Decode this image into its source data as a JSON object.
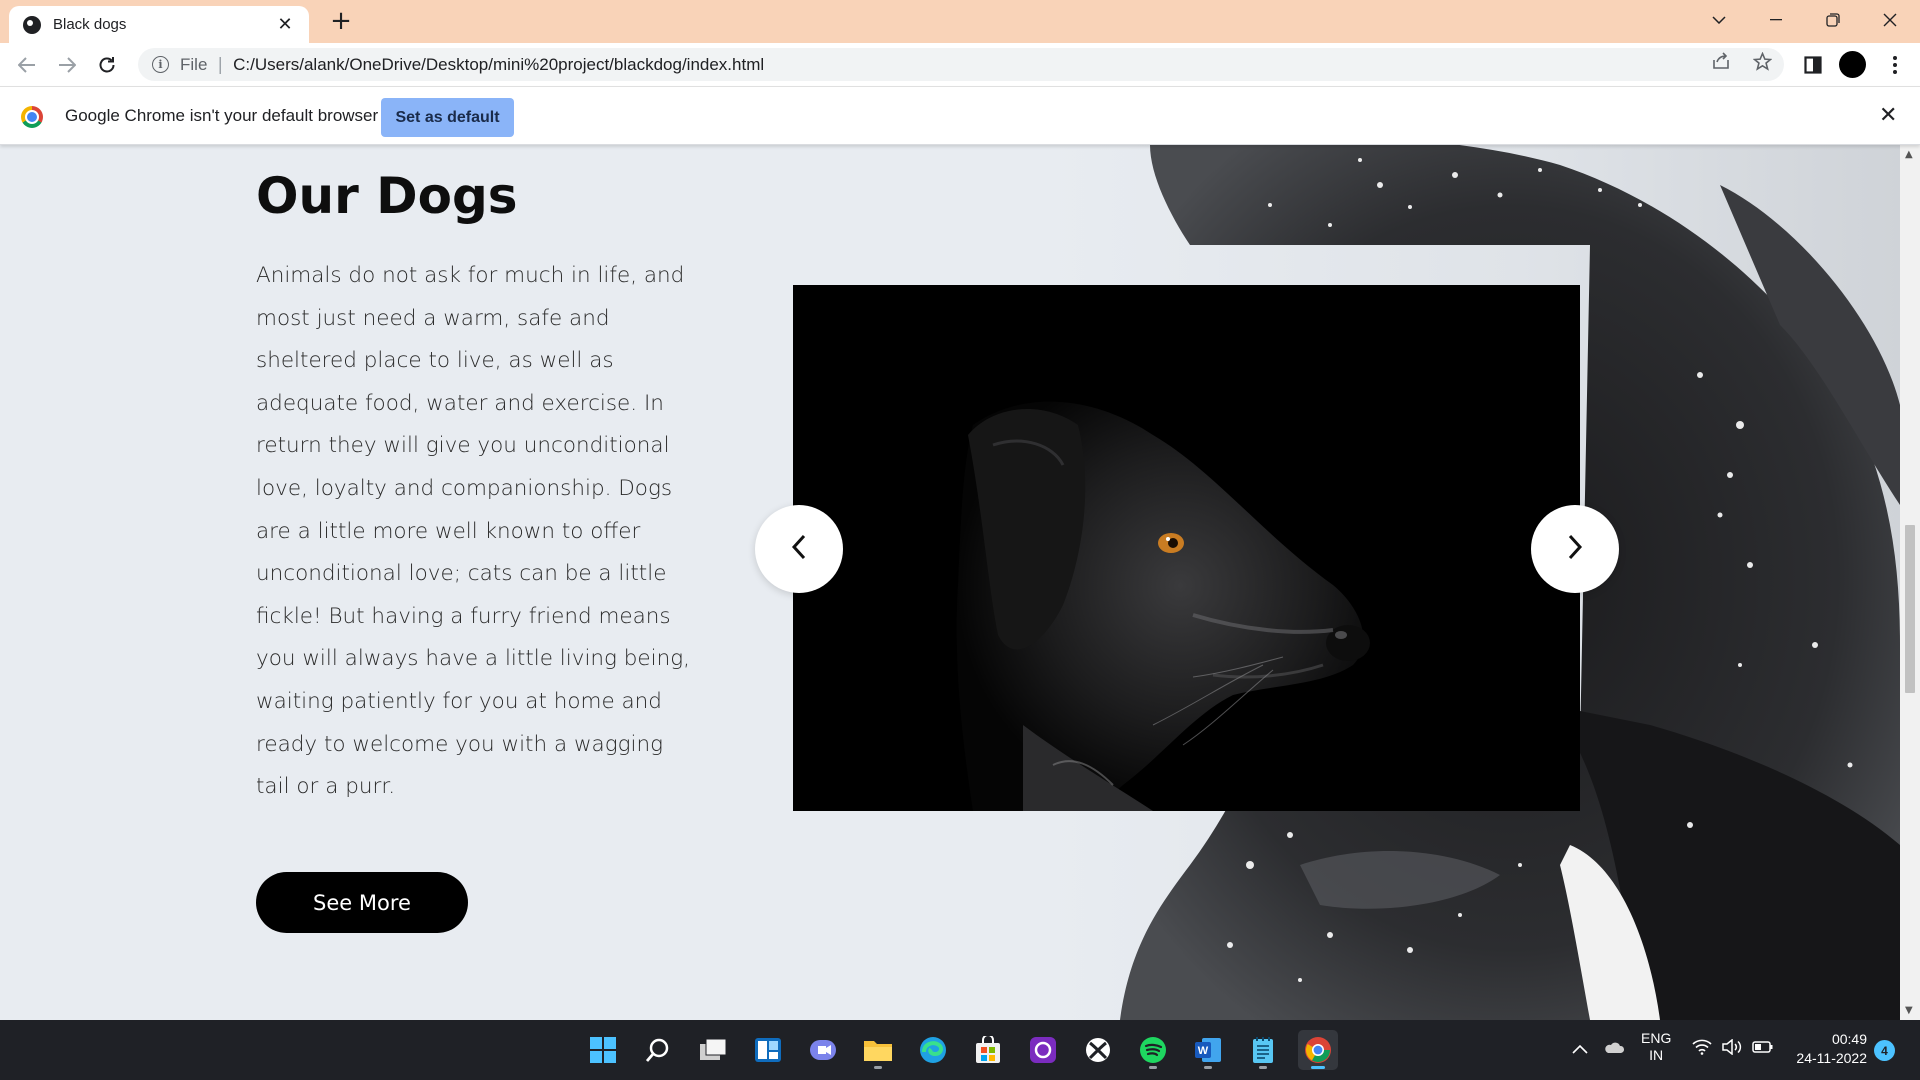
{
  "browser": {
    "tab": {
      "title": "Black dogs",
      "favicon": "globe-icon",
      "close_icon": "close-icon"
    },
    "new_tab_icon": "plus-icon",
    "window_controls": [
      "tab-search-icon",
      "minimize-icon",
      "restore-icon",
      "close-icon"
    ],
    "nav": [
      "back-icon",
      "forward-icon",
      "reload-icon"
    ],
    "address": {
      "scheme_label": "File",
      "url": "C:/Users/alank/OneDrive/Desktop/mini%20project/blackdog/index.html"
    },
    "toolbar_icons": [
      "share-icon",
      "bookmark-star-icon",
      "side-panel-icon",
      "profile-avatar",
      "more-menu-icon"
    ]
  },
  "infobar": {
    "message": "Google Chrome isn't your default browser",
    "button_label": "Set as default"
  },
  "page": {
    "heading": "Our Dogs",
    "paragraph": "Animals do not ask for much in life, and most just need a warm, safe and sheltered place to live, as well as adequate food, water and exercise. In return they will give you unconditional love, loyalty and companionship. Dogs are a little more well known to offer unconditional love; cats can be a little fickle! But having a furry friend means you will always have a little living being, waiting patiently for you at home and ready to welcome you with a wagging tail or a purr.",
    "button_label": "See More",
    "carousel": {
      "prev_icon": "chevron-left-icon",
      "next_icon": "chevron-right-icon"
    }
  },
  "taskbar": {
    "apps": [
      "windows-start-icon",
      "search-icon",
      "task-view-icon",
      "widgets-icon",
      "teams-chat-icon",
      "file-explorer-icon",
      "edge-icon",
      "store-icon",
      "app-icon",
      "xbox-icon",
      "spotify-icon",
      "word-icon",
      "notepad-icon",
      "chrome-icon"
    ],
    "tray": {
      "language_line1": "ENG",
      "language_line2": "IN",
      "time": "00:49",
      "date": "24-11-2022",
      "notifications": "4"
    }
  },
  "colors": {
    "tabstrip": "#f9d3b8",
    "page_bg": "#e8ecf1",
    "infobar_button": "#8ab4f8",
    "taskbar": "#1f2126",
    "accent": "#4cc2ff"
  }
}
